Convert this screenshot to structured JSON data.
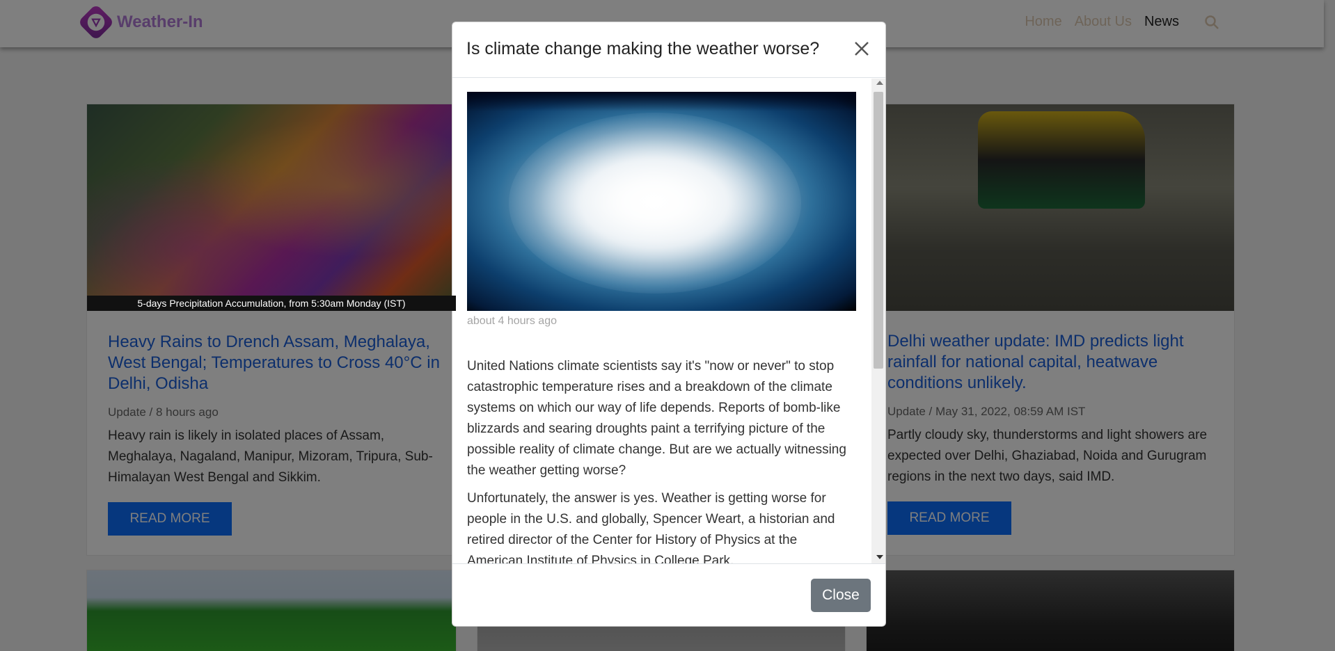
{
  "nav": {
    "brand": "Weather-In",
    "links": [
      "Home",
      "About Us",
      "News"
    ],
    "active": "News"
  },
  "cards": [
    {
      "caption": "5-days Precipitation Accumulation, from 5:30am Monday (IST)",
      "title": "Heavy Rains to Drench Assam, Meghalaya, West Bengal; Temperatures to Cross 40°C in Delhi, Odisha",
      "meta": "Update / 8 hours ago",
      "text": "Heavy rain is likely in isolated places of Assam, Meghalaya, Nagaland, Manipur, Mizoram, Tripura, Sub-Himalayan West Bengal and Sikkim.",
      "button": "READ MORE"
    },
    {
      "title": "Delhi weather update: IMD predicts light rainfall for national capital, heatwave conditions unlikely.",
      "meta": "Update / May 31, 2022, 08:59 AM IST",
      "text": "Partly cloudy sky, thunderstorms and light showers are expected over Delhi, Ghaziabad, Noida and Gurugram regions in the next two days, said IMD.",
      "button": "READ MORE"
    }
  ],
  "modal": {
    "title": "Is climate change making the weather worse?",
    "time": "about 4 hours ago",
    "paragraphs": [
      "United Nations climate scientists say it's \"now or never\" to stop catastrophic temperature rises and a breakdown of the climate systems on which our way of life depends. Reports of bomb-like blizzards and searing droughts paint a terrifying picture of the possible reality of climate change. But are we actually witnessing the weather getting worse?",
      "Unfortunately, the answer is yes. Weather is getting worse for people in the U.S. and globally, Spencer Weart, a historian and retired director of the Center for History of Physics at the American Institute of Physics in College Park,"
    ],
    "close_label": "Close"
  }
}
